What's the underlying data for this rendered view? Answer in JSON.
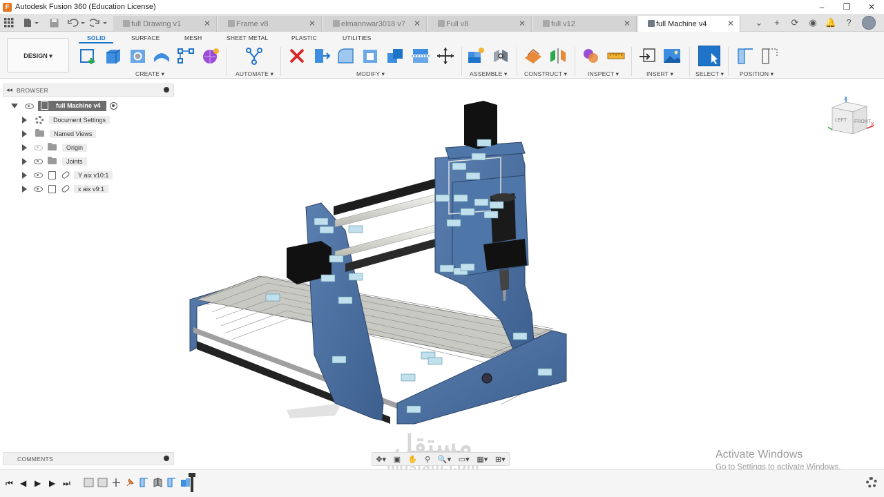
{
  "window": {
    "title": "Autodesk Fusion 360 (Education License)",
    "controls": [
      "–",
      "❐",
      "✕"
    ]
  },
  "tabs": [
    {
      "label": "full Drawing v1",
      "active": false
    },
    {
      "label": "Frame v8",
      "active": false
    },
    {
      "label": "elmannwar3018 v7",
      "active": false
    },
    {
      "label": "Full v8",
      "active": false
    },
    {
      "label": "full v12",
      "active": false
    },
    {
      "label": "full Machine v4",
      "active": true
    }
  ],
  "toolbar": {
    "workspace": "DESIGN ▾",
    "categories": [
      "SOLID",
      "SURFACE",
      "MESH",
      "SHEET METAL",
      "PLASTIC",
      "UTILITIES"
    ],
    "groups": [
      "CREATE ▾",
      "AUTOMATE ▾",
      "MODIFY ▾",
      "ASSEMBLE ▾",
      "CONSTRUCT ▾",
      "INSPECT ▾",
      "INSERT ▾",
      "SELECT ▾",
      "POSITION ▾"
    ],
    "accent": "#1e74c8"
  },
  "browser": {
    "title": "BROWSER",
    "root": "full Machine v4",
    "items": [
      {
        "label": "Document Settings",
        "icon": "gear-icon"
      },
      {
        "label": "Named Views",
        "icon": "folder-icon"
      },
      {
        "label": "Origin",
        "icon": "folder-icon"
      },
      {
        "label": "Joints",
        "icon": "folder-icon"
      },
      {
        "label": "Y aix v10:1",
        "icon": "component-icon"
      },
      {
        "label": "x aix v9:1",
        "icon": "component-icon"
      }
    ]
  },
  "comments": {
    "title": "COMMENTS"
  },
  "viewcube": {
    "left": "LEFT",
    "front": "FRONT",
    "z": "Z",
    "x": "X"
  },
  "activate": {
    "line1": "Activate Windows",
    "line2": "Go to Settings to activate Windows."
  },
  "watermark": {
    "arabic": "مستقل",
    "latin": "mostaql.com"
  }
}
